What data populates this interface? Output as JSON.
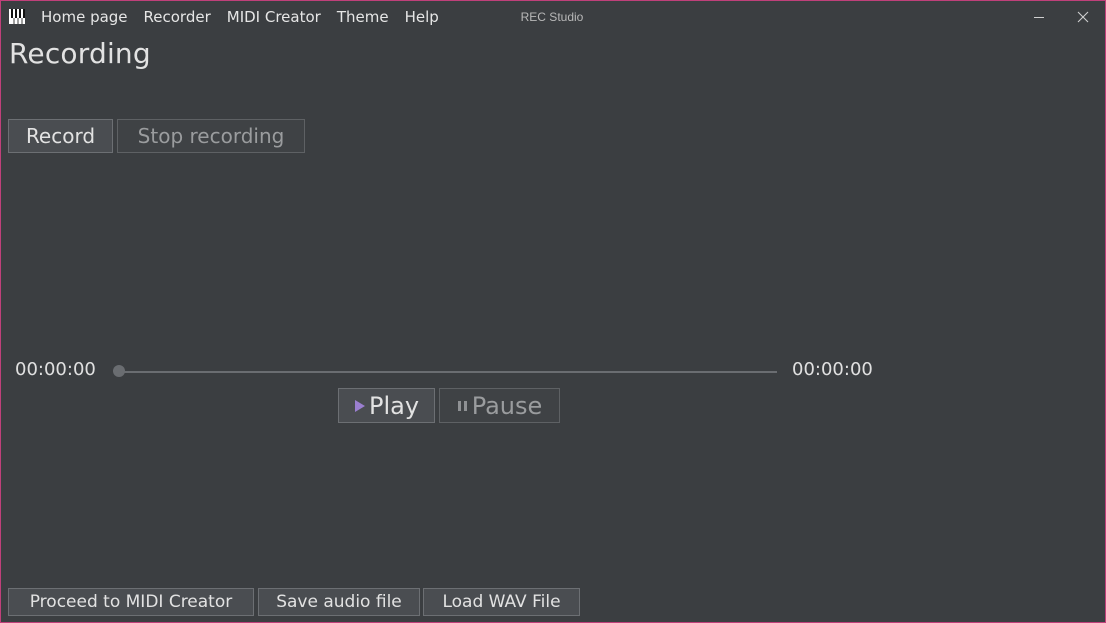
{
  "window": {
    "title": "REC Studio",
    "border_color": "#c0407a",
    "icon": "piano-keys-icon"
  },
  "menu": {
    "items": [
      "Home page",
      "Recorder",
      "MIDI Creator",
      "Theme",
      "Help"
    ]
  },
  "window_controls": {
    "minimize_icon": "minimize-icon",
    "close_icon": "close-icon"
  },
  "page": {
    "title": "Recording"
  },
  "recording": {
    "record_label": "Record",
    "stop_label": "Stop recording",
    "stop_disabled": true
  },
  "player": {
    "current_time": "00:00:00",
    "total_time": "00:00:00",
    "progress": 0,
    "play_label": "Play",
    "play_icon": "play-icon",
    "play_icon_color": "#9b7fd0",
    "pause_label": "Pause",
    "pause_icon": "pause-icon",
    "pause_disabled": true
  },
  "actions": {
    "proceed_label": "Proceed to MIDI Creator",
    "save_label": "Save audio file",
    "load_label": "Load WAV File"
  }
}
